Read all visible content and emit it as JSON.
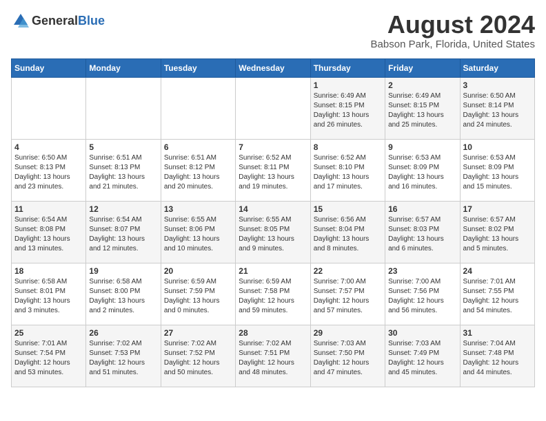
{
  "logo": {
    "general": "General",
    "blue": "Blue"
  },
  "header": {
    "month": "August 2024",
    "location": "Babson Park, Florida, United States"
  },
  "weekdays": [
    "Sunday",
    "Monday",
    "Tuesday",
    "Wednesday",
    "Thursday",
    "Friday",
    "Saturday"
  ],
  "weeks": [
    [
      {
        "day": "",
        "info": ""
      },
      {
        "day": "",
        "info": ""
      },
      {
        "day": "",
        "info": ""
      },
      {
        "day": "",
        "info": ""
      },
      {
        "day": "1",
        "info": "Sunrise: 6:49 AM\nSunset: 8:15 PM\nDaylight: 13 hours\nand 26 minutes."
      },
      {
        "day": "2",
        "info": "Sunrise: 6:49 AM\nSunset: 8:15 PM\nDaylight: 13 hours\nand 25 minutes."
      },
      {
        "day": "3",
        "info": "Sunrise: 6:50 AM\nSunset: 8:14 PM\nDaylight: 13 hours\nand 24 minutes."
      }
    ],
    [
      {
        "day": "4",
        "info": "Sunrise: 6:50 AM\nSunset: 8:13 PM\nDaylight: 13 hours\nand 23 minutes."
      },
      {
        "day": "5",
        "info": "Sunrise: 6:51 AM\nSunset: 8:13 PM\nDaylight: 13 hours\nand 21 minutes."
      },
      {
        "day": "6",
        "info": "Sunrise: 6:51 AM\nSunset: 8:12 PM\nDaylight: 13 hours\nand 20 minutes."
      },
      {
        "day": "7",
        "info": "Sunrise: 6:52 AM\nSunset: 8:11 PM\nDaylight: 13 hours\nand 19 minutes."
      },
      {
        "day": "8",
        "info": "Sunrise: 6:52 AM\nSunset: 8:10 PM\nDaylight: 13 hours\nand 17 minutes."
      },
      {
        "day": "9",
        "info": "Sunrise: 6:53 AM\nSunset: 8:09 PM\nDaylight: 13 hours\nand 16 minutes."
      },
      {
        "day": "10",
        "info": "Sunrise: 6:53 AM\nSunset: 8:09 PM\nDaylight: 13 hours\nand 15 minutes."
      }
    ],
    [
      {
        "day": "11",
        "info": "Sunrise: 6:54 AM\nSunset: 8:08 PM\nDaylight: 13 hours\nand 13 minutes."
      },
      {
        "day": "12",
        "info": "Sunrise: 6:54 AM\nSunset: 8:07 PM\nDaylight: 13 hours\nand 12 minutes."
      },
      {
        "day": "13",
        "info": "Sunrise: 6:55 AM\nSunset: 8:06 PM\nDaylight: 13 hours\nand 10 minutes."
      },
      {
        "day": "14",
        "info": "Sunrise: 6:55 AM\nSunset: 8:05 PM\nDaylight: 13 hours\nand 9 minutes."
      },
      {
        "day": "15",
        "info": "Sunrise: 6:56 AM\nSunset: 8:04 PM\nDaylight: 13 hours\nand 8 minutes."
      },
      {
        "day": "16",
        "info": "Sunrise: 6:57 AM\nSunset: 8:03 PM\nDaylight: 13 hours\nand 6 minutes."
      },
      {
        "day": "17",
        "info": "Sunrise: 6:57 AM\nSunset: 8:02 PM\nDaylight: 13 hours\nand 5 minutes."
      }
    ],
    [
      {
        "day": "18",
        "info": "Sunrise: 6:58 AM\nSunset: 8:01 PM\nDaylight: 13 hours\nand 3 minutes."
      },
      {
        "day": "19",
        "info": "Sunrise: 6:58 AM\nSunset: 8:00 PM\nDaylight: 13 hours\nand 2 minutes."
      },
      {
        "day": "20",
        "info": "Sunrise: 6:59 AM\nSunset: 7:59 PM\nDaylight: 13 hours\nand 0 minutes."
      },
      {
        "day": "21",
        "info": "Sunrise: 6:59 AM\nSunset: 7:58 PM\nDaylight: 12 hours\nand 59 minutes."
      },
      {
        "day": "22",
        "info": "Sunrise: 7:00 AM\nSunset: 7:57 PM\nDaylight: 12 hours\nand 57 minutes."
      },
      {
        "day": "23",
        "info": "Sunrise: 7:00 AM\nSunset: 7:56 PM\nDaylight: 12 hours\nand 56 minutes."
      },
      {
        "day": "24",
        "info": "Sunrise: 7:01 AM\nSunset: 7:55 PM\nDaylight: 12 hours\nand 54 minutes."
      }
    ],
    [
      {
        "day": "25",
        "info": "Sunrise: 7:01 AM\nSunset: 7:54 PM\nDaylight: 12 hours\nand 53 minutes."
      },
      {
        "day": "26",
        "info": "Sunrise: 7:02 AM\nSunset: 7:53 PM\nDaylight: 12 hours\nand 51 minutes."
      },
      {
        "day": "27",
        "info": "Sunrise: 7:02 AM\nSunset: 7:52 PM\nDaylight: 12 hours\nand 50 minutes."
      },
      {
        "day": "28",
        "info": "Sunrise: 7:02 AM\nSunset: 7:51 PM\nDaylight: 12 hours\nand 48 minutes."
      },
      {
        "day": "29",
        "info": "Sunrise: 7:03 AM\nSunset: 7:50 PM\nDaylight: 12 hours\nand 47 minutes."
      },
      {
        "day": "30",
        "info": "Sunrise: 7:03 AM\nSunset: 7:49 PM\nDaylight: 12 hours\nand 45 minutes."
      },
      {
        "day": "31",
        "info": "Sunrise: 7:04 AM\nSunset: 7:48 PM\nDaylight: 12 hours\nand 44 minutes."
      }
    ]
  ]
}
